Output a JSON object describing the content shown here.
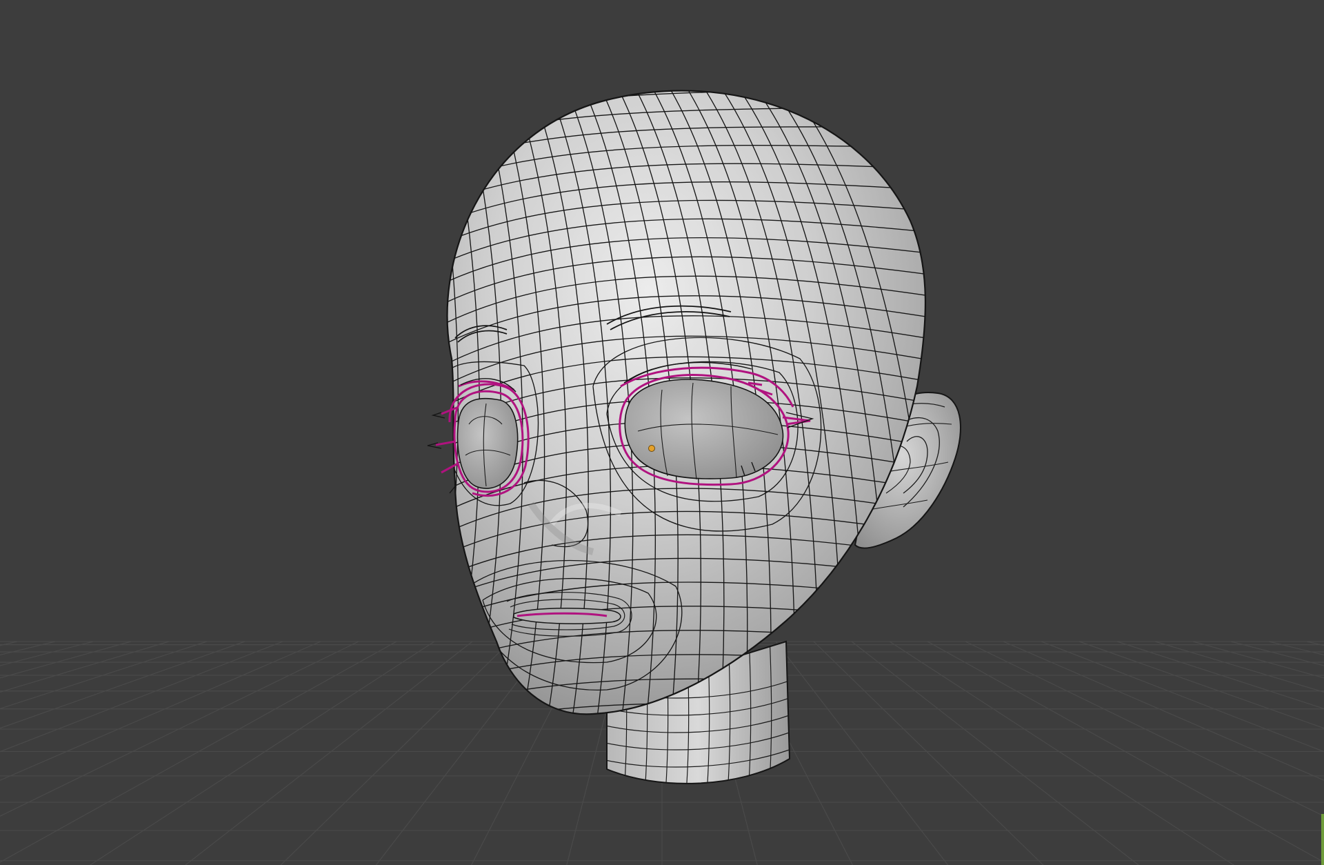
{
  "viewport": {
    "background_color": "#3d3d3d",
    "grid_color": "#4a4a4a",
    "view_mode": "edit-mode-wireframe-overlay",
    "object": "stylized-head-mesh"
  },
  "mesh": {
    "surface_color": "#c9c9c9",
    "edge_color": "#151515",
    "selected_edge_color": "#b0127f",
    "origin_color": "#e5a12a",
    "selection": [
      "eye-loop-right",
      "eye-loop-left",
      "mouth-loop"
    ]
  },
  "colors": {
    "window_edge_accent": "#6e9c3a"
  }
}
